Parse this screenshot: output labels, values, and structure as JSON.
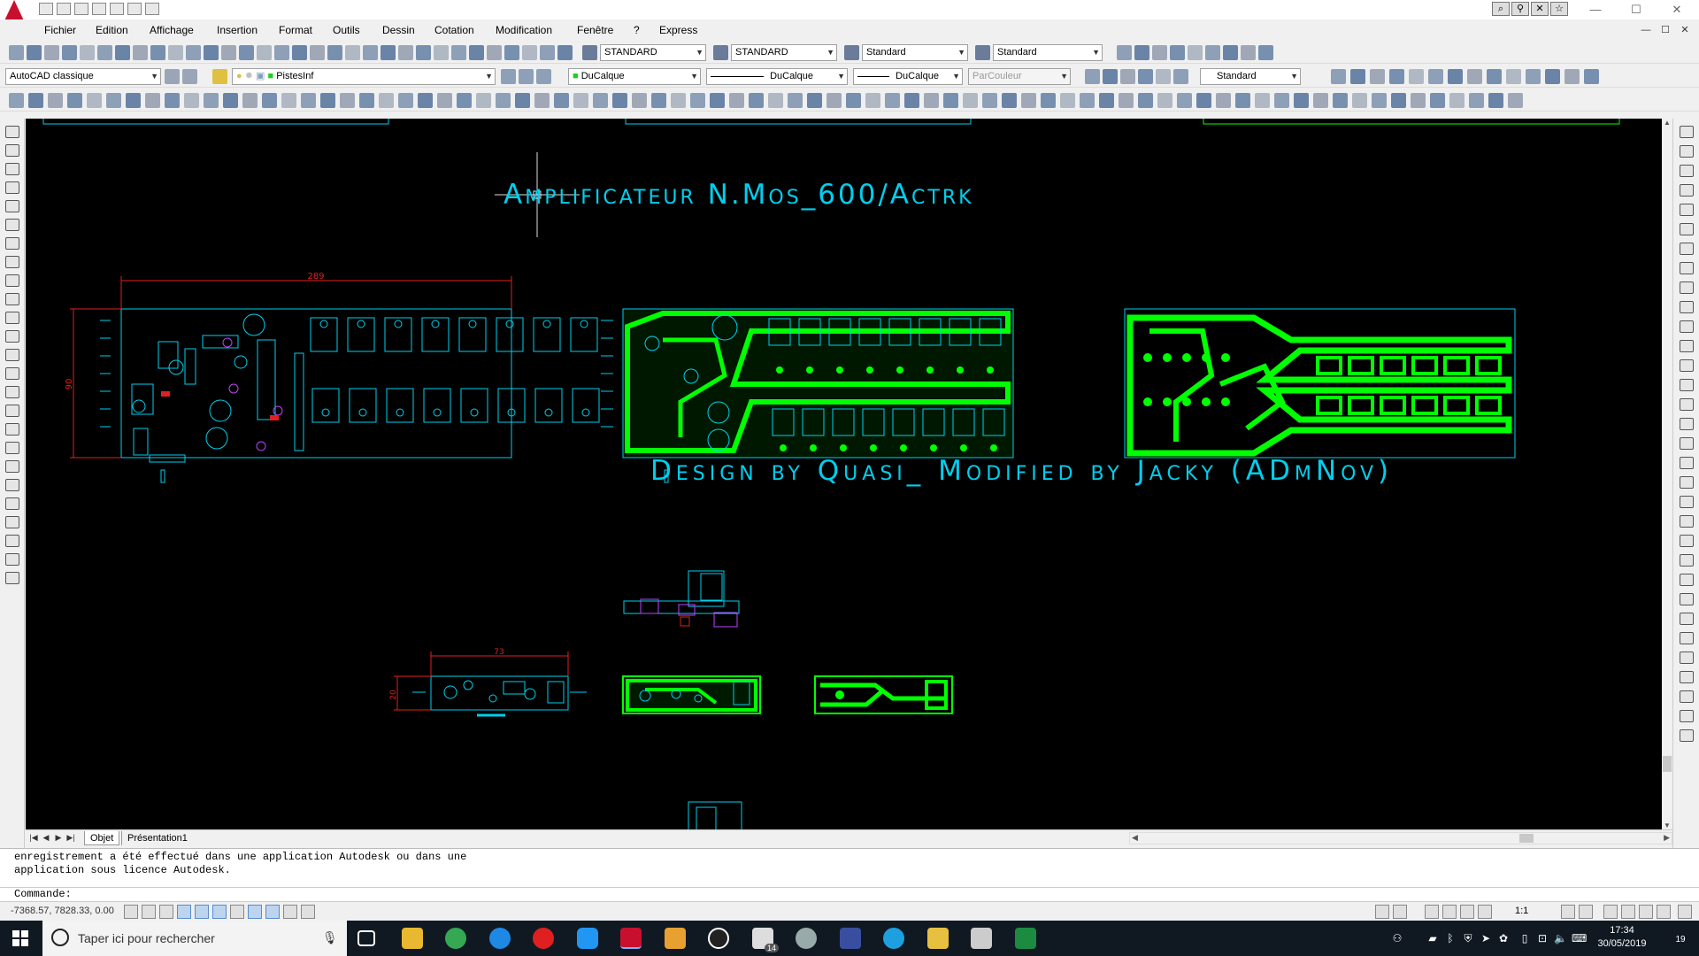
{
  "window": {
    "app_name": "AutoCAD",
    "controls": {
      "minimize": "—",
      "maximize": "☐",
      "close": "✕"
    }
  },
  "menu": {
    "items": [
      "Fichier",
      "Edition",
      "Affichage",
      "Insertion",
      "Format",
      "Outils",
      "Dessin",
      "Cotation",
      "Modification",
      "Fenêtre",
      "?",
      "Express"
    ]
  },
  "toolbar2": {
    "text_style": "STANDARD",
    "dim_style": "STANDARD",
    "table_style": "Standard",
    "mleader_style": "Standard"
  },
  "toolbar3": {
    "workspace": "AutoCAD classique",
    "layer": "PistesInf",
    "color": "DuCalque",
    "linetype": "DuCalque",
    "lineweight": "DuCalque",
    "plotstyle": "ParCouleur",
    "scale_style": "Standard"
  },
  "drawing": {
    "title": "Amplificateur N.Mos_600/Actrk",
    "subtitle": "Design by Quasi_ Modified by Jacky (ADμNov)",
    "dim_large_width": "289",
    "dim_large_height": "90",
    "dim_small_width": "73",
    "dim_small_height": "20",
    "colors": {
      "background": "#000000",
      "cyan": "#00cfee",
      "green": "#00ff00",
      "red": "#e02020"
    }
  },
  "layout_tabs": {
    "model": "Objet",
    "layout1": "Présentation1"
  },
  "command": {
    "history_line1": "enregistrement a été effectué dans une application Autodesk ou dans une",
    "history_line2": "application sous licence Autodesk.",
    "prompt": "Commande:"
  },
  "status": {
    "coordinates": "-7368.57, 7828.33, 0.00",
    "annotation_scale": "1:1"
  },
  "taskbar": {
    "search_placeholder": "Taper ici pour rechercher",
    "mail_badge": "14",
    "time": "17:34",
    "date": "30/05/2019",
    "notification_count": "19"
  }
}
